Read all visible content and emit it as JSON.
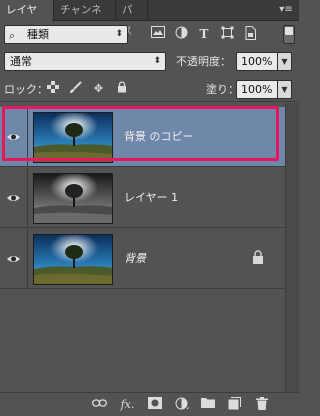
{
  "tabs": [
    {
      "label": "レイヤー",
      "active": true
    },
    {
      "label": "チャンネル",
      "active": false
    },
    {
      "label": "パス",
      "active": false
    }
  ],
  "panel_menu_icon": "panel-menu-icon",
  "filter": {
    "kind_label": "種類",
    "icons": [
      "pixel-filter-icon",
      "adjustment-filter-icon",
      "type-filter-icon",
      "shape-filter-icon",
      "smart-object-filter-icon"
    ]
  },
  "blend": {
    "mode": "通常",
    "opacity_label": "不透明度：",
    "opacity_value": "100%"
  },
  "lock": {
    "label": "ロック：",
    "icons": [
      "lock-transparent-icon",
      "lock-image-icon",
      "lock-position-icon",
      "lock-all-icon"
    ],
    "fill_label": "塗り：",
    "fill_value": "100%"
  },
  "layers": [
    {
      "name": "背景 のコピー",
      "selected": true,
      "visible": true,
      "locked": false,
      "thumb": "color"
    },
    {
      "name": "レイヤー 1",
      "selected": false,
      "visible": true,
      "locked": false,
      "thumb": "mono"
    },
    {
      "name": "背景",
      "selected": false,
      "visible": true,
      "locked": true,
      "thumb": "color"
    }
  ],
  "bottom_icons": [
    "link-icon",
    "fx-icon",
    "mask-icon",
    "adjustment-icon",
    "group-folder-icon",
    "new-layer-icon",
    "trash-icon"
  ],
  "colors": {
    "panel_bg": "#535353",
    "selected_layer": "#6f87a8",
    "highlight_frame": "#e8175d"
  }
}
